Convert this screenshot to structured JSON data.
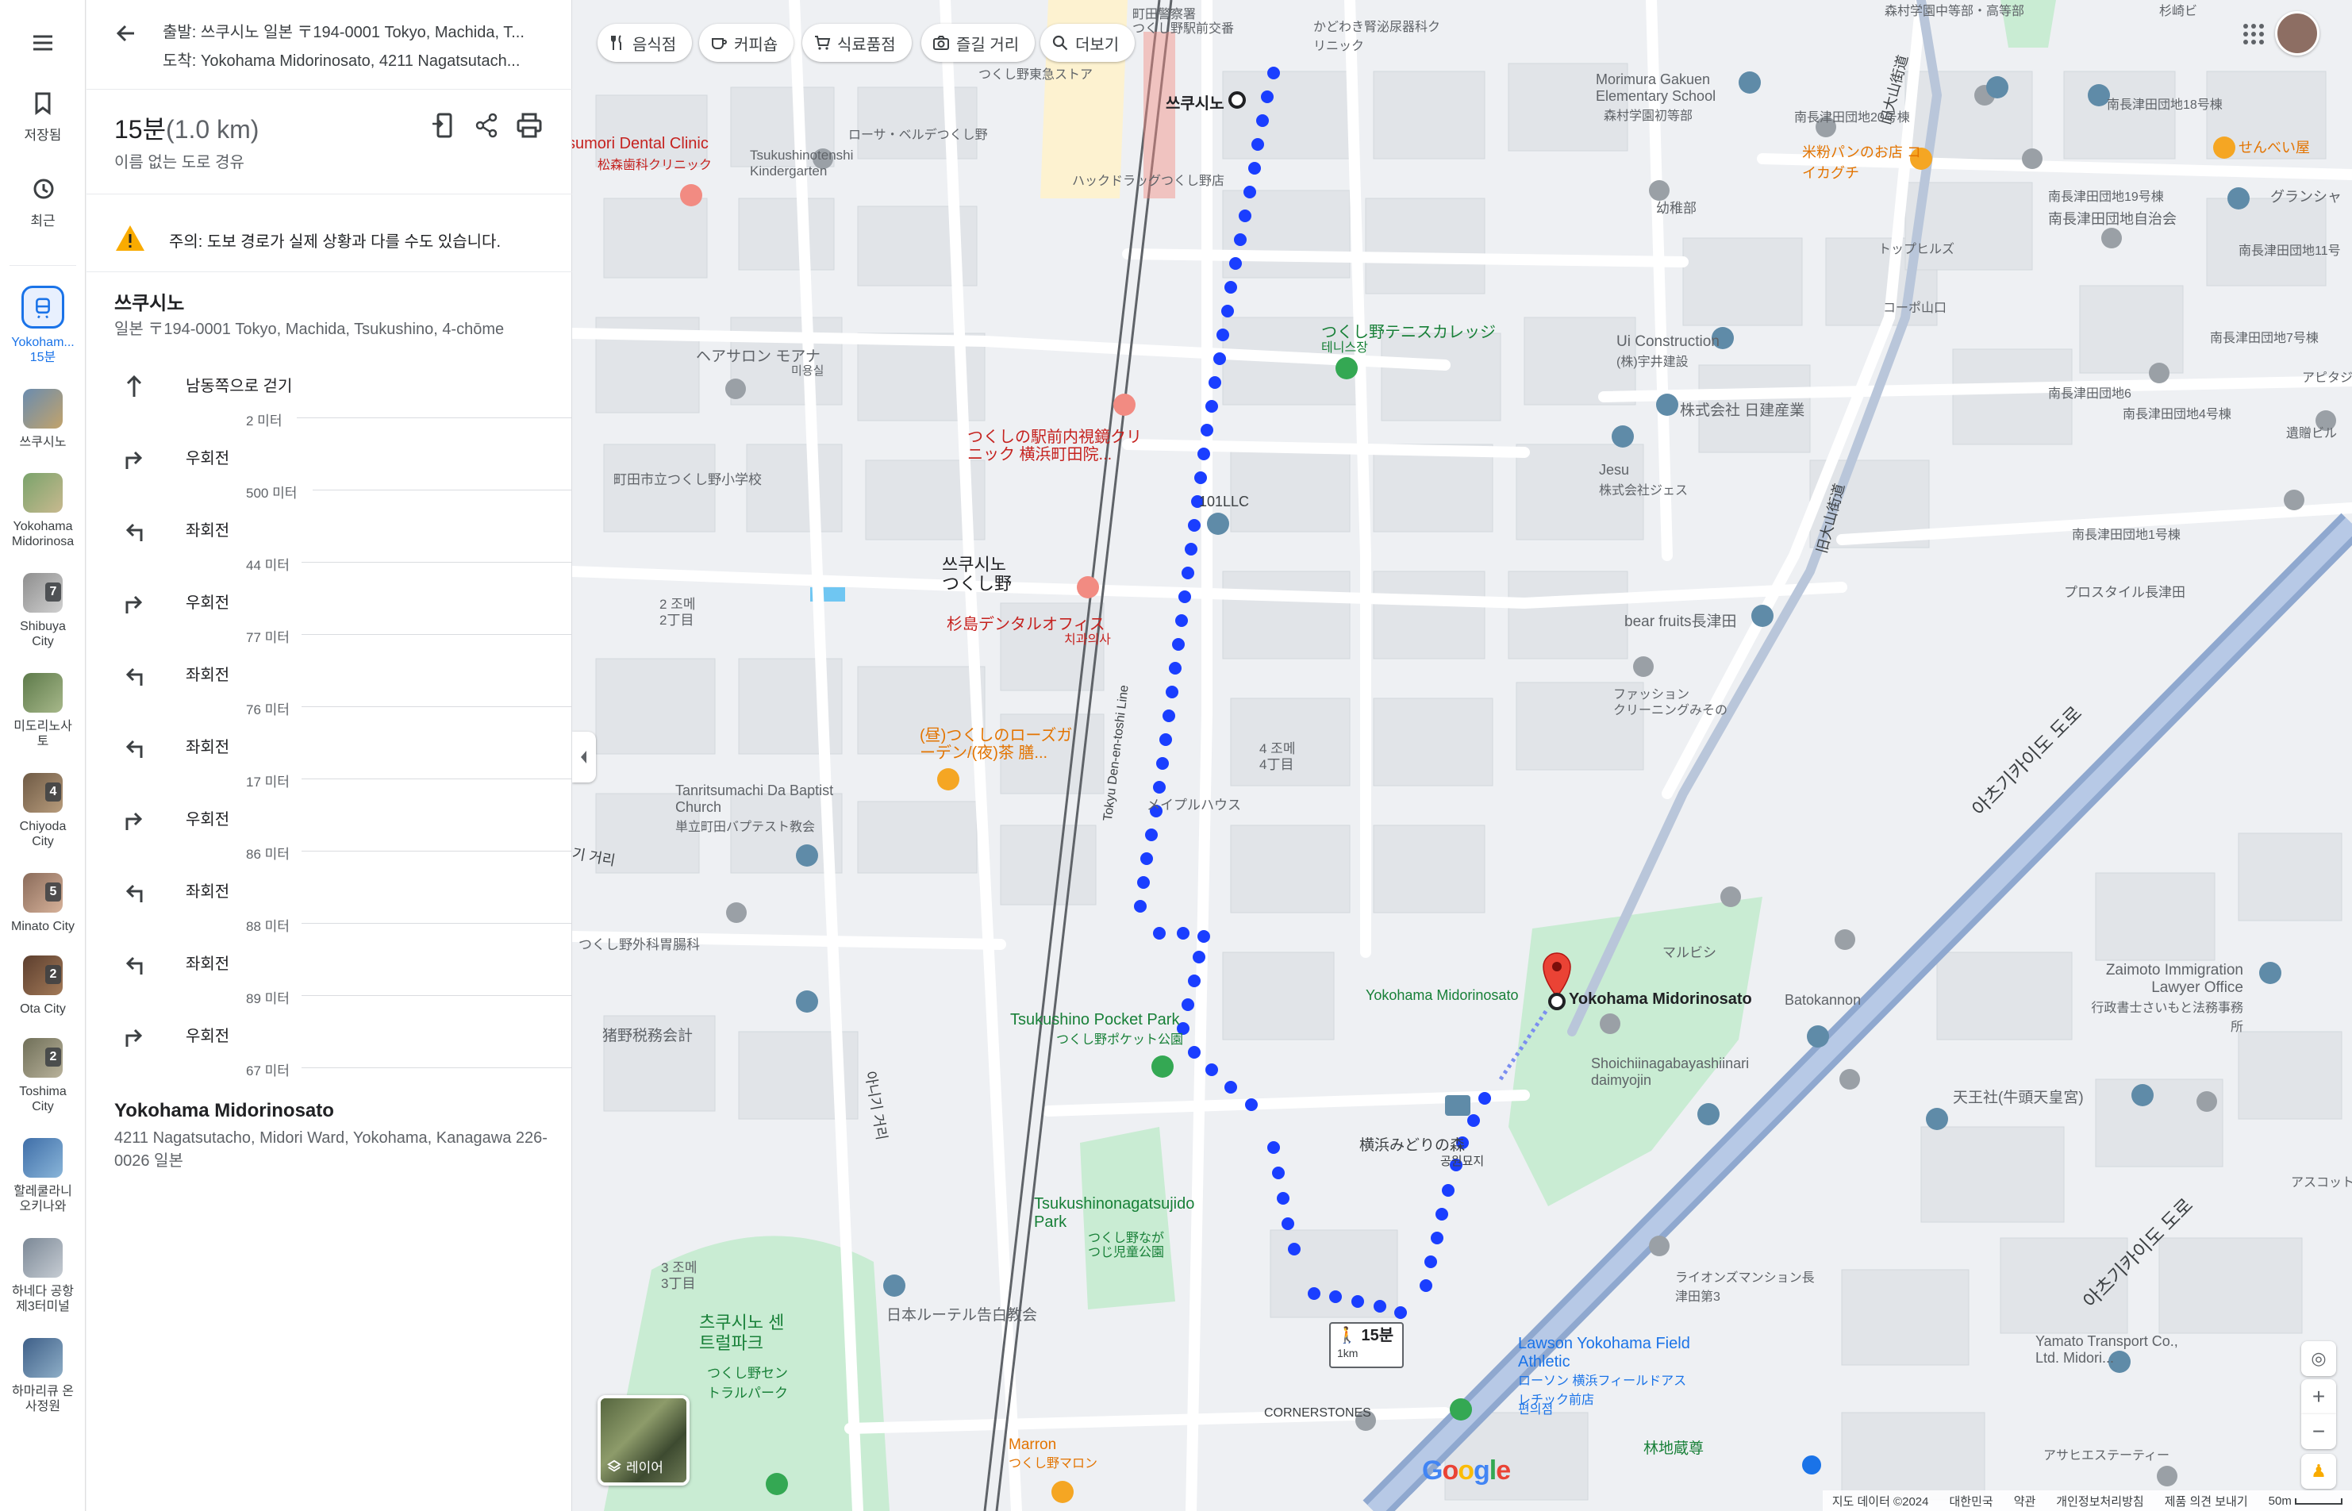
{
  "rail": {
    "saved_label": "저장됨",
    "recent_label": "최근",
    "active_label_line1": "Yokoham...",
    "active_label_line2": "15분",
    "history": [
      {
        "label": "쓰쿠시노",
        "badge": ""
      },
      {
        "label": "Yokohama Midorinosa",
        "badge": ""
      },
      {
        "label": "Shibuya City",
        "badge": "7"
      },
      {
        "label": "미도리노사토",
        "badge": ""
      },
      {
        "label": "Chiyoda City",
        "badge": "4"
      },
      {
        "label": "Minato City",
        "badge": "5"
      },
      {
        "label": "Ota City",
        "badge": "2"
      },
      {
        "label": "Toshima City",
        "badge": "2"
      },
      {
        "label": "할레쿨라니 오키나와",
        "badge": ""
      },
      {
        "label": "하네다 공항 제3터미널",
        "badge": ""
      },
      {
        "label": "하마리큐 온사정원",
        "badge": ""
      }
    ]
  },
  "directions": {
    "origin_line": "출발: 쓰쿠시노 일본 〒194-0001 Tokyo, Machida, T...",
    "destination_line": "도착: Yokohama Midorinosato, 4211 Nagatsutach...",
    "time": "15분",
    "distance": "(1.0 km)",
    "route_desc": "이름 없는 도로 경유",
    "warning": "주의: 도보 경로가 실제 상황과 다를 수도 있습니다.",
    "origin_title": "쓰쿠시노",
    "origin_addr": "일본 〒194-0001 Tokyo, Machida, Tsukushino, 4-chōme",
    "steps": [
      {
        "action": "남동쪽으로 걷기",
        "dir": "straight",
        "dist": "2 미터"
      },
      {
        "action": "우회전",
        "dir": "right",
        "dist": "500 미터"
      },
      {
        "action": "좌회전",
        "dir": "left",
        "dist": "44 미터"
      },
      {
        "action": "우회전",
        "dir": "right",
        "dist": "77 미터"
      },
      {
        "action": "좌회전",
        "dir": "left",
        "dist": "76 미터"
      },
      {
        "action": "좌회전",
        "dir": "left",
        "dist": "17 미터"
      },
      {
        "action": "우회전",
        "dir": "right",
        "dist": "86 미터"
      },
      {
        "action": "좌회전",
        "dir": "left",
        "dist": "88 미터"
      },
      {
        "action": "좌회전",
        "dir": "left",
        "dist": "89 미터"
      },
      {
        "action": "우회전",
        "dir": "right",
        "dist": "67 미터"
      }
    ],
    "dest_title": "Yokohama Midorinosato",
    "dest_addr": "4211 Nagatsutacho, Midori Ward, Yokohama, Kanagawa 226-0026 일본"
  },
  "map": {
    "chips": [
      {
        "label": "음식점",
        "icon": "fork-knife-icon"
      },
      {
        "label": "커피숍",
        "icon": "coffee-icon"
      },
      {
        "label": "식료품점",
        "icon": "cart-icon"
      },
      {
        "label": "즐길 거리",
        "icon": "camera-icon"
      },
      {
        "label": "더보기",
        "icon": "search-icon"
      }
    ],
    "layers_label": "레이어",
    "route_badge_time": "15분",
    "route_badge_dist": "1km",
    "google": "Google",
    "footer": [
      "지도 데이터 ©2024",
      "대한민국",
      "약관",
      "개인정보처리방침",
      "제품 의견 보내기",
      "50m"
    ],
    "labels": {
      "origin": "쓰쿠시노",
      "dest": "Yokohama Midorinosato",
      "dest_small": "Yokohama Midorinosato",
      "station": "쓰쿠시노\nつくし野",
      "expressway": "아츠기카이도 도로",
      "expressway2": "아츠기카이도 도로",
      "dental": "sumori Dental Clinic",
      "dental_jp": "松森歯科クリニック",
      "kinder": "Tsukushinotenshi Kindergarten",
      "morimura": "Morimura Gakuen Elementary School",
      "morimura_jp": "森村学園初等部",
      "tennis": "つくし野テニスカレッジ",
      "tennis_sub": "테니스장",
      "ui": "Ui Construction",
      "ui_jp": "(株)宇井建設",
      "nikken": "株式会社 日建産業",
      "jesu": "Jesu",
      "jesu_jp": "株式会社ジェス",
      "llc": "101LLC",
      "bearfruits": "bear fruits長津田",
      "fashion": "ファッション\nクリーニングみその",
      "maple": "メイプルハウス",
      "baptist": "Tanritsumachi Da Baptist Church",
      "baptist_jp": "単立町田バプテスト教会",
      "pocket": "Tsukushino Pocket Park",
      "pocket_jp": "つくし野ポケット公園",
      "nagatsuji": "Tsukushinonagatsujido Park",
      "nagatsuji_jp": "つくし野なが\nつじ児童公園",
      "central": "츠쿠시노 센트럴파크",
      "central_jp": "つくし野セントラルパーク",
      "lawson": "Lawson Yokohama Field Athletic",
      "lawson_jp": "ローソン 横浜フィールドアスレチック前店",
      "lawson_sub": "편의점",
      "zaimoto": "Zaimoto Immigration Lawyer Office",
      "zaimoto_jp": "行政書士さいもと法務事務所",
      "yamato": "Yamato Transport Co., Ltd. Midori...",
      "shoichi": "Shoichiinagabayashiinari daimyojin",
      "batokannon": "Batokannon",
      "tenno": "天王社(牛頭天皇宮)",
      "suginoya": "杉島デンタルオフィス",
      "suginoya_sub": "치과의사",
      "megane": "つくしの駅前内視鏡クリニック 横浜町田院...",
      "rose": "(昼)つくしのローズガーデン/(夜)茶 膳...",
      "elementary": "町田市立つくし野小学校",
      "hair": "ヘアサロン モアナ",
      "hair_sub": "미용실",
      "zeirishi": "猪野税務会計",
      "geka": "つくし野外科胃腸科",
      "church": "日本ルーテル告白教会",
      "marron": "Marron",
      "marron_jp": "つくし野マロン",
      "cornerstones": "CORNERSTONES",
      "rinchi": "林地蔵尊",
      "road_oyama": "旧大山街道",
      "road_line": "Tokyu Den-en-toshi Line",
      "road_gil": "아니기 거리",
      "chome2": "2 조메\n2丁目",
      "chome3": "3 조메\n3丁目",
      "chome4": "4 조메\n4丁目",
      "kaidou": "기 거리",
      "yochien": "幼稚部",
      "komeko": "米粉パンのお店 コイカグチ",
      "senbei": "せんべい屋",
      "grancha": "グランシャ",
      "nagatsuta20": "南長津田団地20号棟",
      "nagatsuta18": "南長津田団地18号棟",
      "nagatsuta19": "南長津田団地19号棟",
      "jichikai": "南長津田団地自治会",
      "topphills": "トップヒルズ",
      "minamidanchi11": "南長津田団地11号",
      "corpo": "コーポ山口",
      "danchi7": "南長津田団地7号棟",
      "danchi6": "南長津田団地6",
      "danchi4": "南長津田団地4号棟",
      "danchi1": "南長津田団地1号棟",
      "prostyle": "プロスタイル長津田",
      "marubishi": "マルビシ",
      "lions": "ライオンズマンション長津田第3",
      "yokohama_midori_jp": "横浜みどりの森",
      "yokohama_midori_sub": "공원묘지",
      "kadowaki": "かどわき腎泌尿器科クリニック",
      "police": "町田警察署\nつくし野駅前交番",
      "tokyu": "つくし野東急ストア",
      "hack": "ハックドラッグつくし野店",
      "lohre": "ローサ・ベルデつくし野",
      "morimura_jh": "森村学園中等部・高等部",
      "sugimoto": "杉崎ビ",
      "asahi": "アサヒエステーティー",
      "aska": "アスコット",
      "apideji": "アピタジ",
      "yakusho": "遺贈ビル"
    }
  },
  "colors": {
    "route": "#1a3eff",
    "accent": "#1a73e8",
    "park": "#c9ecd3",
    "expressway": "#8fa8cf",
    "dest_pin": "#ea4335"
  }
}
